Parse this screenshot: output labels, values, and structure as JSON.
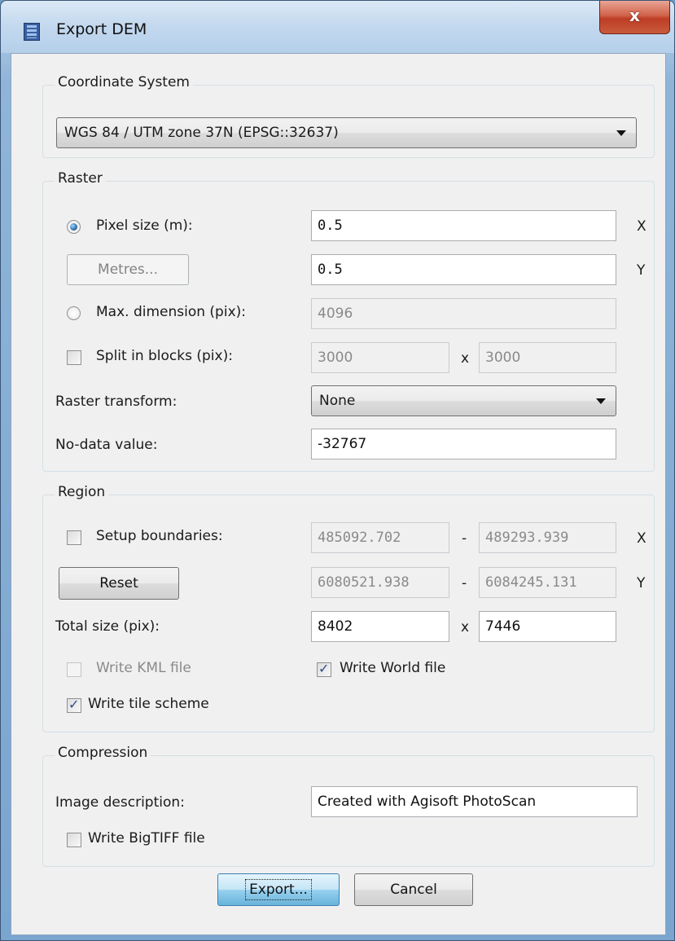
{
  "window": {
    "title": "Export DEM",
    "close_glyph": "x"
  },
  "coordinate_system": {
    "label": "Coordinate System",
    "selected": "WGS 84 / UTM zone 37N (EPSG::32637)"
  },
  "raster": {
    "label": "Raster",
    "pixel_size_label": "Pixel size (m):",
    "pixel_size_x": "0.5",
    "pixel_size_y": "0.5",
    "axis_x": "X",
    "axis_y": "Y",
    "metres_button": "Metres...",
    "max_dimension_label": "Max. dimension (pix):",
    "max_dimension_value": "4096",
    "split_blocks_label": "Split in blocks (pix):",
    "split_blocks_w": "3000",
    "split_blocks_h": "3000",
    "split_sep": "x",
    "transform_label": "Raster transform:",
    "transform_selected": "None",
    "nodata_label": "No-data value:",
    "nodata_value": "-32767"
  },
  "region": {
    "label": "Region",
    "setup_boundaries_label": "Setup boundaries:",
    "x_min": "485092.702",
    "x_max": "489293.939",
    "y_min": "6080521.938",
    "y_max": "6084245.131",
    "range_sep": "-",
    "axis_x": "X",
    "axis_y": "Y",
    "reset_button": "Reset",
    "total_size_label": "Total size (pix):",
    "total_w": "8402",
    "total_h": "7446",
    "size_sep": "x",
    "write_kml_label": "Write KML file",
    "write_world_label": "Write World file",
    "write_tile_label": "Write tile scheme"
  },
  "compression": {
    "label": "Compression",
    "image_description_label": "Image description:",
    "image_description_value": "Created with Agisoft PhotoScan",
    "write_bigtiff_label": "Write BigTIFF file"
  },
  "buttons": {
    "export": "Export...",
    "cancel": "Cancel"
  },
  "state": {
    "pixel_size_selected": true,
    "max_dimension_selected": false,
    "split_blocks_checked": false,
    "setup_boundaries_checked": false,
    "write_kml_checked": false,
    "write_kml_enabled": false,
    "write_world_checked": true,
    "write_tile_checked": true,
    "write_bigtiff_checked": false
  },
  "colors": {
    "window_frame": "#7aa5cf",
    "close_button": "#c94a30",
    "client_bg": "#f0f0f0",
    "default_button": "#98d1ef"
  }
}
